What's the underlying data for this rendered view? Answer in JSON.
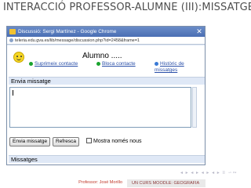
{
  "slide": {
    "title": "INTERACCIÓ PROFESSOR-ALUMNE (III):MISSATGES"
  },
  "window": {
    "title": "Discussió: Sergi Martínez - Google Chrome",
    "url": "teleria.edu.gva.es/lib/message/discussion.php?id=2458&frame=1",
    "student_label": "Alumno ....."
  },
  "actions": {
    "remove": "Suprimeix contacte",
    "block": "Bloca contacte",
    "history": "Històric de missatges"
  },
  "send_section": {
    "heading": "Envia missatge",
    "send_button": "Envia missatge",
    "refresh_button": "Refresca",
    "new_only_label": "Mostra només nous"
  },
  "messages_section": {
    "heading": "Missatges"
  },
  "footer": {
    "author": "Professor: José Morillo",
    "course": "UN CURS MOODLE: GEOGRAFIA"
  },
  "nav_icons": "◂ ▸ ◂ ▸ ◂ ▸ ◂ ▸ ≡ ∽∾"
}
